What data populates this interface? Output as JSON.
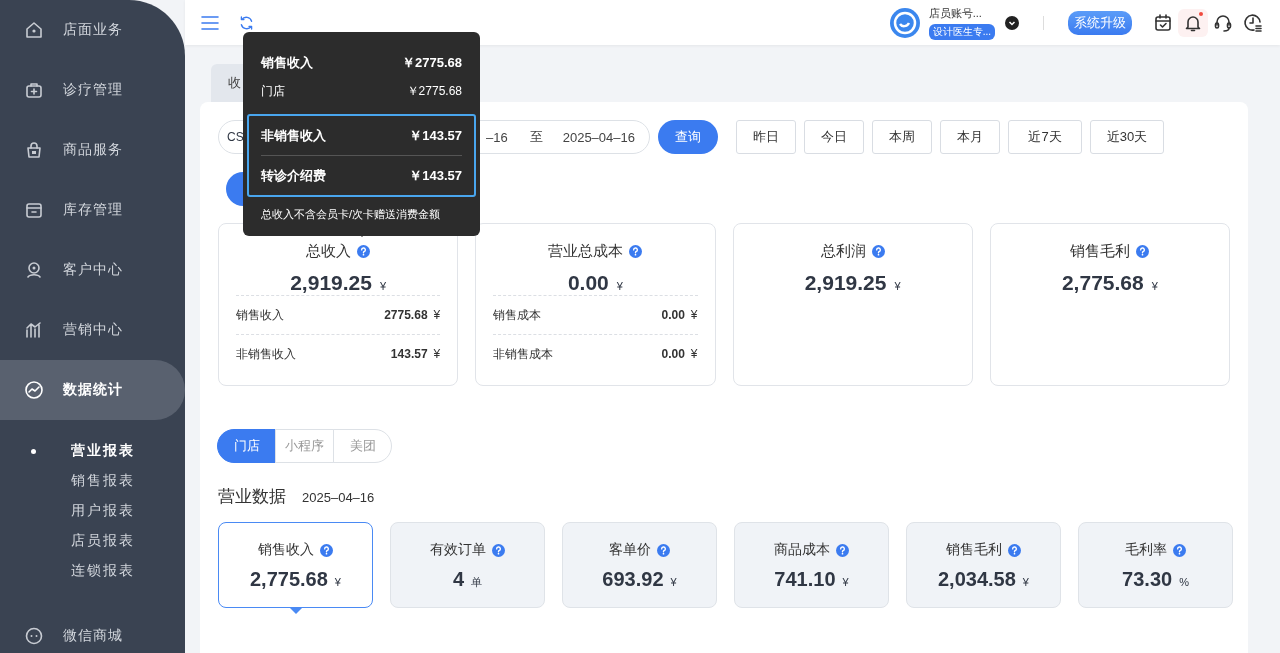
{
  "sidebar": {
    "items": [
      {
        "label": "店面业务",
        "selected": false
      },
      {
        "label": "诊疗管理",
        "selected": false
      },
      {
        "label": "商品服务",
        "selected": false
      },
      {
        "label": "库存管理",
        "selected": false
      },
      {
        "label": "客户中心",
        "selected": false
      },
      {
        "label": "营销中心",
        "selected": false
      },
      {
        "label": "数据统计",
        "selected": true,
        "expanded": true,
        "children": [
          {
            "label": "营业报表",
            "selected": true
          },
          {
            "label": "销售报表",
            "selected": false
          },
          {
            "label": "用户报表",
            "selected": false
          },
          {
            "label": "店员报表",
            "selected": false
          },
          {
            "label": "连锁报表",
            "selected": false
          }
        ]
      },
      {
        "label": "微信商城",
        "selected": false
      }
    ]
  },
  "header": {
    "account_name": "店员账号...",
    "account_role": "设计医生专...",
    "upgrade_button": "系统升级",
    "notification_dot": true
  },
  "tabs": [
    {
      "label": "收",
      "selected": false
    }
  ],
  "filters": {
    "store": "CS",
    "date_start": "–16",
    "date_separator": "至",
    "date_end": "2025–04–16",
    "query_button": "查询",
    "quick_ranges": [
      {
        "label": "昨日",
        "selected": false
      },
      {
        "label": "今日",
        "selected": false
      },
      {
        "label": "本周",
        "selected": false
      },
      {
        "label": "本月",
        "selected": false
      },
      {
        "label": "近7天",
        "selected": false
      },
      {
        "label": "近30天",
        "selected": false
      }
    ]
  },
  "summary_cards": [
    {
      "title": "总收入",
      "value": "2,919.25",
      "unit": "¥",
      "details": [
        {
          "label": "销售收入",
          "value": "2775.68",
          "unit": "¥"
        },
        {
          "label": "非销售收入",
          "value": "143.57",
          "unit": "¥"
        }
      ]
    },
    {
      "title": "营业总成本",
      "value": "0.00",
      "unit": "¥",
      "details": [
        {
          "label": "销售成本",
          "value": "0.00",
          "unit": "¥"
        },
        {
          "label": "非销售成本",
          "value": "0.00",
          "unit": "¥"
        }
      ]
    },
    {
      "title": "总利润",
      "value": "2,919.25",
      "unit": "¥"
    },
    {
      "title": "销售毛利",
      "value": "2,775.68",
      "unit": "¥"
    }
  ],
  "tooltip": {
    "groups": [
      {
        "highlighted": false,
        "rows": [
          {
            "kind": "total",
            "label": "销售收入",
            "value": "￥2775.68"
          },
          {
            "kind": "item",
            "label": "门店",
            "value": "￥2775.68"
          }
        ]
      },
      {
        "highlighted": true,
        "rows": [
          {
            "kind": "total",
            "label": "非销售收入",
            "value": "￥143.57"
          },
          {
            "kind": "total",
            "label": "转诊介绍费",
            "value": "￥143.57"
          }
        ]
      }
    ],
    "note": "总收入不含会员卡/次卡赠送消费金额"
  },
  "channels": [
    {
      "label": "门店",
      "selected": true
    },
    {
      "label": "小程序",
      "selected": false
    },
    {
      "label": "美团",
      "selected": false
    }
  ],
  "business": {
    "title": "营业数据",
    "date": "2025–04–16",
    "metrics": [
      {
        "title": "销售收入",
        "value": "2,775.68",
        "unit": "¥",
        "selected": true
      },
      {
        "title": "有效订单",
        "value": "4",
        "unit": "单",
        "selected": false
      },
      {
        "title": "客单价",
        "value": "693.92",
        "unit": "¥",
        "selected": false
      },
      {
        "title": "商品成本",
        "value": "741.10",
        "unit": "¥",
        "selected": false
      },
      {
        "title": "销售毛利",
        "value": "2,034.58",
        "unit": "¥",
        "selected": false
      },
      {
        "title": "毛利率",
        "value": "73.30",
        "unit": "%",
        "selected": false
      }
    ]
  }
}
